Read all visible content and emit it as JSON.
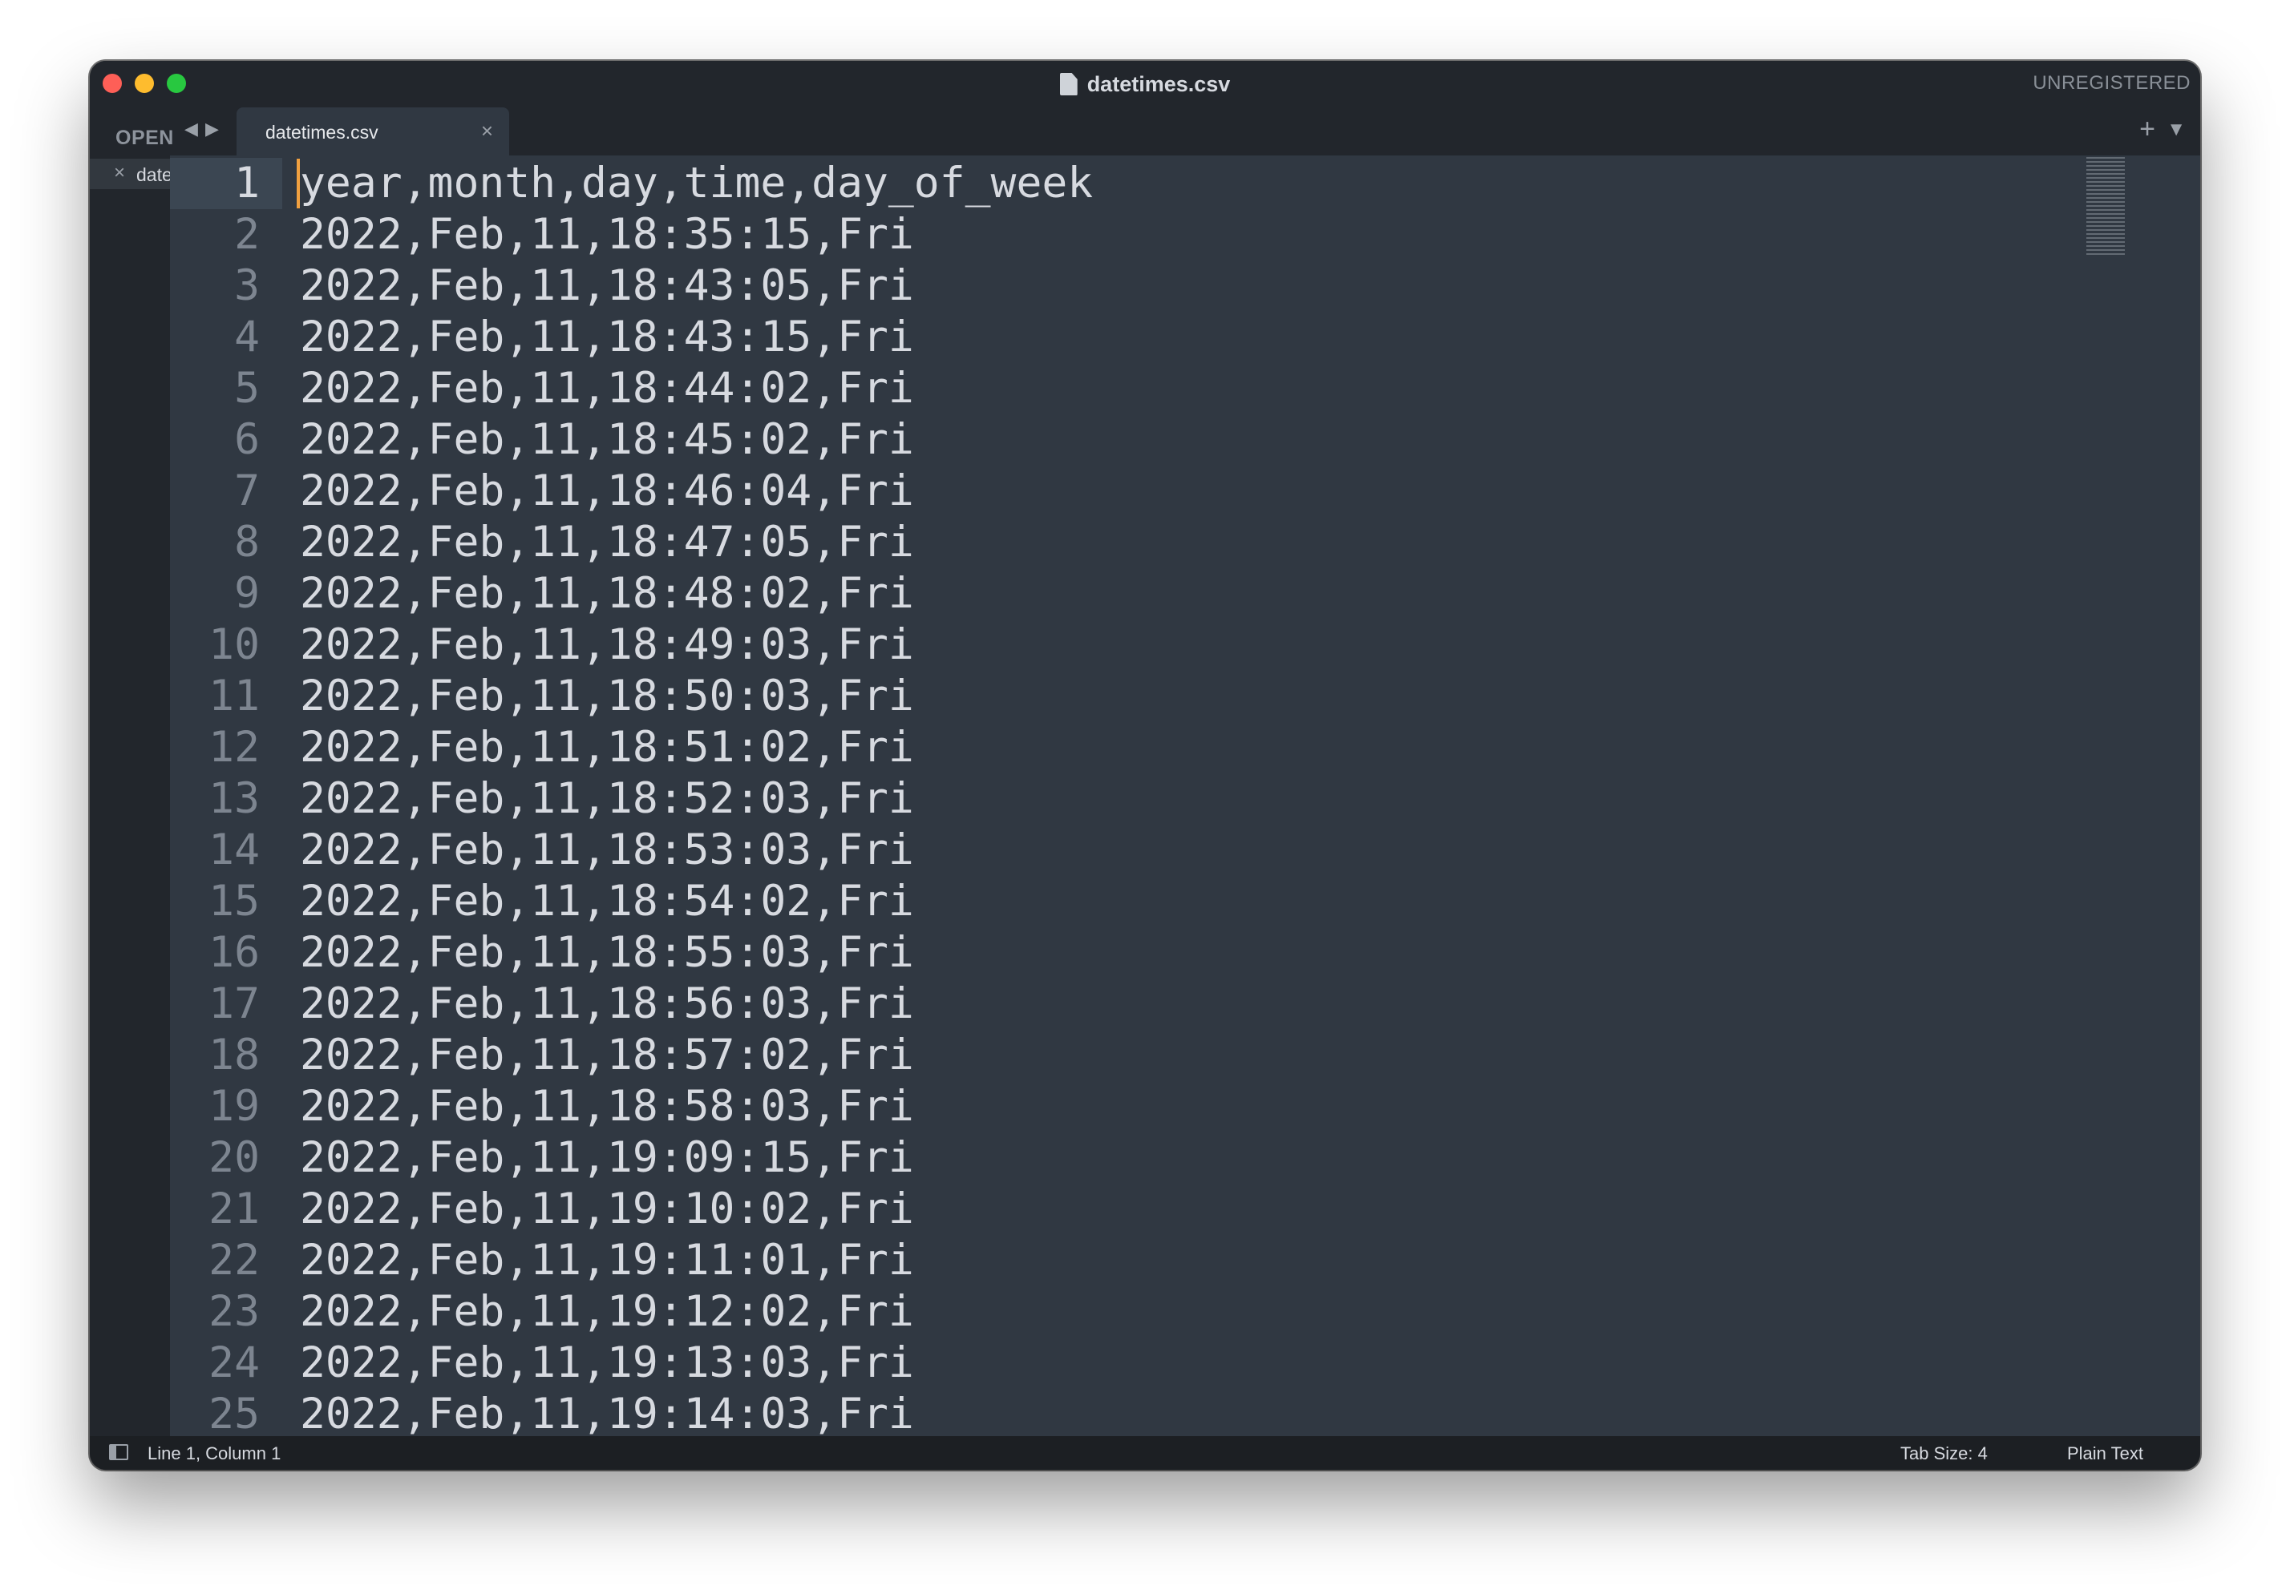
{
  "window": {
    "title": "datetimes.csv",
    "registration": "UNREGISTERED"
  },
  "tabbar": {
    "open_label": "OPEN FILES",
    "back_icon": "◀",
    "forward_icon": "▶",
    "tab_label": "datetimes.csv",
    "tab_close": "×",
    "new_tab": "+",
    "tab_menu": "▼"
  },
  "sidebar": {
    "close_icon": "×",
    "file_name": "datetimes.csv"
  },
  "editor": {
    "lines": [
      "year,month,day,time,day_of_week",
      "2022,Feb,11,18:35:15,Fri",
      "2022,Feb,11,18:43:05,Fri",
      "2022,Feb,11,18:43:15,Fri",
      "2022,Feb,11,18:44:02,Fri",
      "2022,Feb,11,18:45:02,Fri",
      "2022,Feb,11,18:46:04,Fri",
      "2022,Feb,11,18:47:05,Fri",
      "2022,Feb,11,18:48:02,Fri",
      "2022,Feb,11,18:49:03,Fri",
      "2022,Feb,11,18:50:03,Fri",
      "2022,Feb,11,18:51:02,Fri",
      "2022,Feb,11,18:52:03,Fri",
      "2022,Feb,11,18:53:03,Fri",
      "2022,Feb,11,18:54:02,Fri",
      "2022,Feb,11,18:55:03,Fri",
      "2022,Feb,11,18:56:03,Fri",
      "2022,Feb,11,18:57:02,Fri",
      "2022,Feb,11,18:58:03,Fri",
      "2022,Feb,11,19:09:15,Fri",
      "2022,Feb,11,19:10:02,Fri",
      "2022,Feb,11,19:11:01,Fri",
      "2022,Feb,11,19:12:02,Fri",
      "2022,Feb,11,19:13:03,Fri",
      "2022,Feb,11,19:14:03,Fri"
    ],
    "active_line": 1
  },
  "statusbar": {
    "position": "Line 1, Column 1",
    "tab_size": "Tab Size: 4",
    "syntax": "Plain Text"
  },
  "colors": {
    "editor_bg": "#303842",
    "chrome_bg": "#22262c",
    "text": "#d7dae0",
    "line_number": "#7d8590",
    "caret": "#f0a040"
  },
  "icons": {
    "title_file": "file-icon",
    "sidebar_toggle": "sidebar-toggle-icon",
    "minimap": "minimap"
  }
}
